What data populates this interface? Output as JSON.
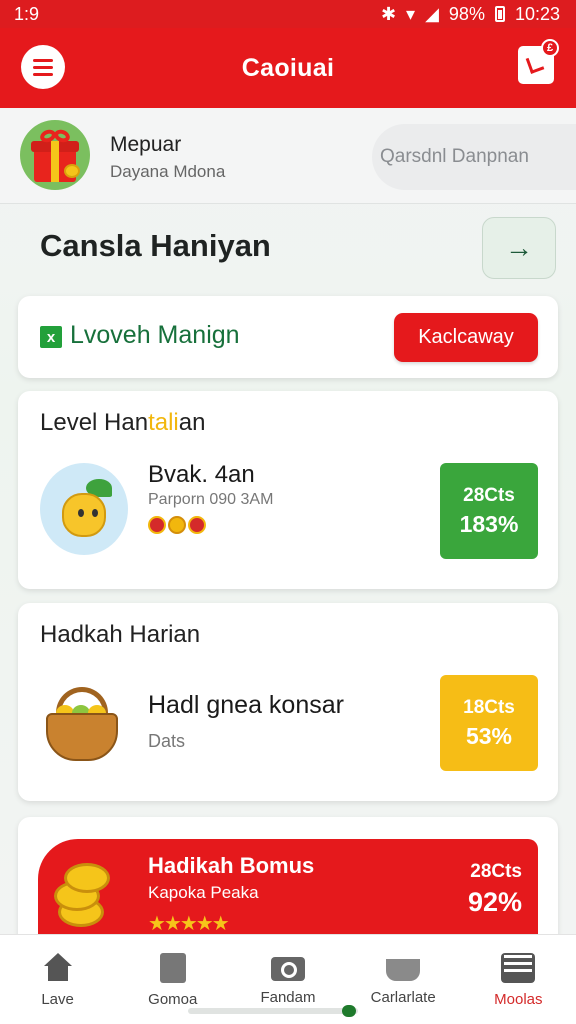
{
  "status_bar": {
    "time_left": "1:9",
    "battery": "98%",
    "time_right": "10:23"
  },
  "app_bar": {
    "title": "Caoiuai",
    "calendar_badge": "£"
  },
  "profile": {
    "name": "Mepuar",
    "subtitle": "Dayana Mdona",
    "search_placeholder": "Qarsdnl Danpnan"
  },
  "section": {
    "heading": "Cansla Haniyan",
    "arrow": "→"
  },
  "promo": {
    "icon": "x",
    "title": "Lvoveh Manign",
    "button_label": "Kaclcaway"
  },
  "level_card": {
    "title_prefix": "Level Han",
    "title_highlight": "tali",
    "title_suffix": "an",
    "item_name": "Bvak. 4an",
    "item_meta": "Parporn 090 3AM",
    "stat_top": "28Cts",
    "stat_bottom": "183%"
  },
  "daily_card": {
    "title": "Hadkah Harian",
    "item_name": "Hadl gnea konsar",
    "item_meta": "Dats",
    "stat_top": "18Cts",
    "stat_bottom": "53%"
  },
  "bonus_card": {
    "title": "Hadikah Bomus",
    "subtitle": "Kapoka Peaka",
    "stars": "★★★★★",
    "stat_top": "28Cts",
    "stat_bottom": "92%"
  },
  "bottom_nav": [
    {
      "label": "Lave",
      "icon": "home-icon"
    },
    {
      "label": "Gomoa",
      "icon": "document-icon"
    },
    {
      "label": "Fandam",
      "icon": "camera-icon"
    },
    {
      "label": "Carlarlate",
      "icon": "basket-icon"
    },
    {
      "label": "Moolas",
      "icon": "list-icon",
      "active": true
    }
  ],
  "colors": {
    "brand_red": "#e5191c",
    "green": "#3aa63c",
    "yellow": "#f6bd16"
  }
}
